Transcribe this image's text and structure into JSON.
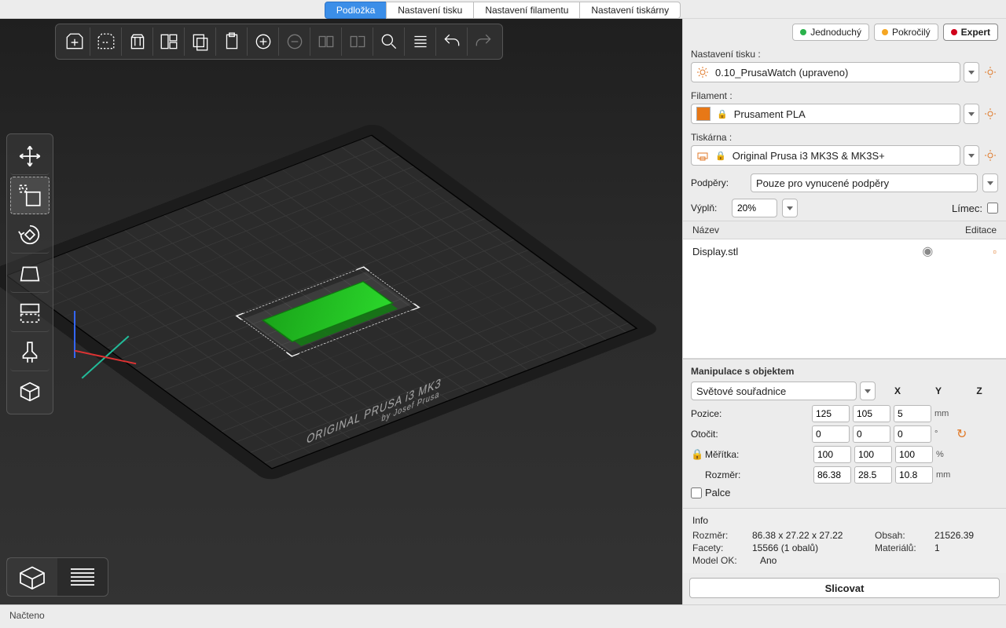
{
  "tabs": {
    "plater": "Podložka",
    "print": "Nastavení tisku",
    "filament": "Nastavení filamentu",
    "printer": "Nastavení tiskárny"
  },
  "modes": {
    "simple": "Jednoduchý",
    "advanced": "Pokročilý",
    "expert": "Expert"
  },
  "panel": {
    "print_label": "Nastavení tisku :",
    "print_value": "0.10_PrusaWatch (upraveno)",
    "filament_label": "Filament :",
    "filament_value": "Prusament PLA",
    "printer_label": "Tiskárna :",
    "printer_value": "Original Prusa i3 MK3S & MK3S+",
    "supports_label": "Podpěry:",
    "supports_value": "Pouze pro vynucené podpěry",
    "infill_label": "Výplň:",
    "infill_value": "20%",
    "brim_label": "Límec:"
  },
  "object_header": {
    "name": "Název",
    "edit": "Editace"
  },
  "object": {
    "name": "Display.stl"
  },
  "manip": {
    "title": "Manipulace s objektem",
    "coord_system": "Světové souřadnice",
    "axes": {
      "x": "X",
      "y": "Y",
      "z": "Z"
    },
    "position": {
      "label": "Pozice:",
      "x": "125",
      "y": "105",
      "z": "5",
      "unit": "mm"
    },
    "rotate": {
      "label": "Otočit:",
      "x": "0",
      "y": "0",
      "z": "0",
      "unit": "°"
    },
    "scale": {
      "label": "Měřítka:",
      "x": "100",
      "y": "100",
      "z": "100",
      "unit": "%"
    },
    "size": {
      "label": "Rozměr:",
      "x": "86.38",
      "y": "28.5",
      "z": "10.8",
      "unit": "mm"
    },
    "inches": "Palce"
  },
  "info": {
    "title": "Info",
    "size_label": "Rozměr:",
    "size_value": "86.38 x 27.22 x 27.22",
    "volume_label": "Obsah:",
    "volume_value": "21526.39",
    "facets_label": "Facety:",
    "facets_value": "15566 (1 obalů)",
    "materials_label": "Materiálů:",
    "materials_value": "1",
    "modelok_label": "Model OK:",
    "modelok_value": "Ano"
  },
  "slice": "Slicovat",
  "bed_label": {
    "main": "ORIGINAL PRUSA i3 MK3",
    "sub": "by Josef Prusa"
  },
  "status": "Načteno"
}
